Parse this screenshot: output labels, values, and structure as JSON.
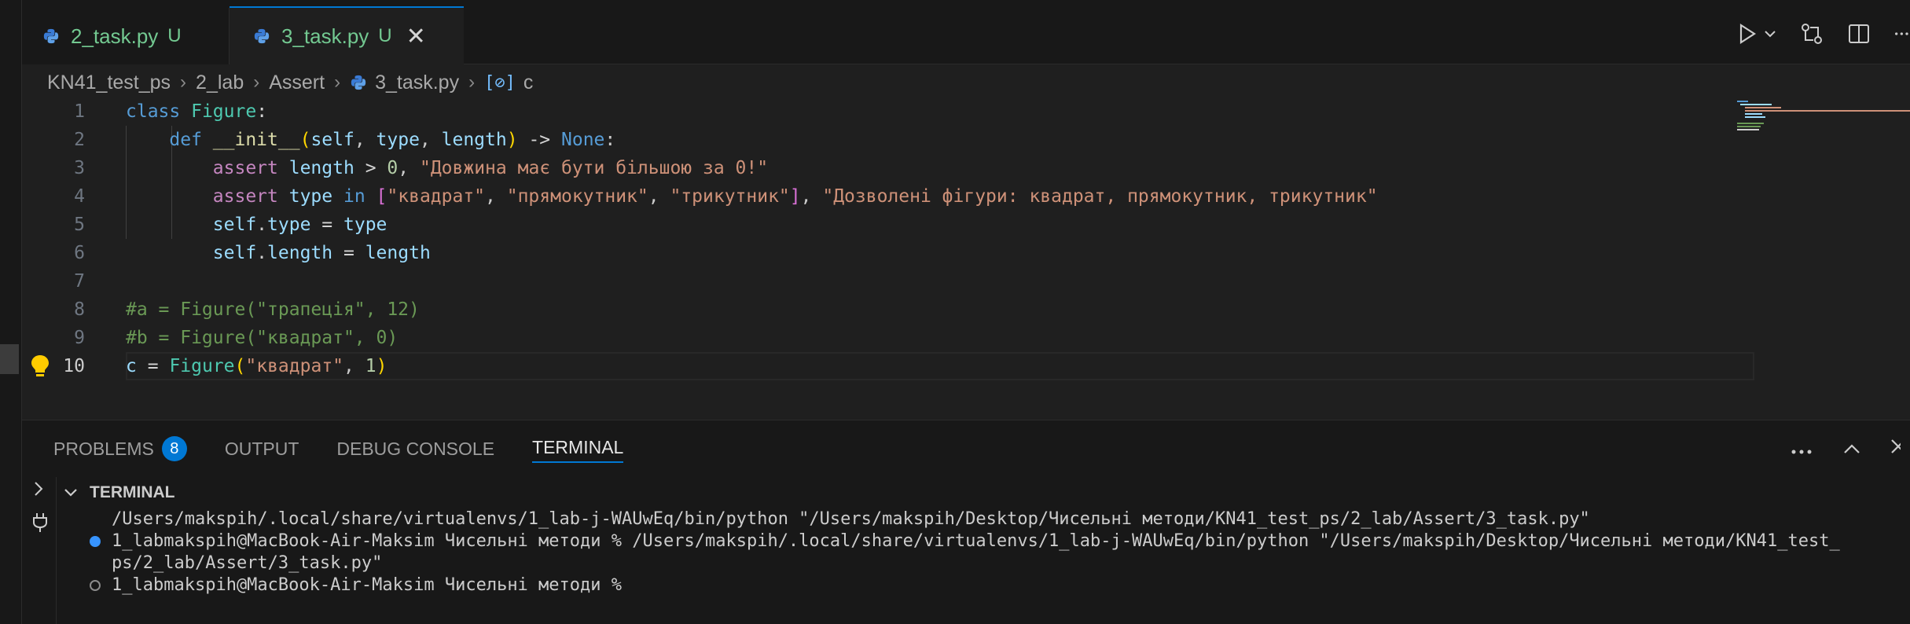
{
  "tabs": [
    {
      "label": "2_task.py",
      "status": "U",
      "active": false
    },
    {
      "label": "3_task.py",
      "status": "U",
      "active": true,
      "close": "✕"
    }
  ],
  "breadcrumb": [
    "KN41_test_ps",
    "2_lab",
    "Assert",
    "3_task.py",
    "c"
  ],
  "editor": {
    "lines": [
      {
        "n": "1"
      },
      {
        "n": "2"
      },
      {
        "n": "3"
      },
      {
        "n": "4"
      },
      {
        "n": "5"
      },
      {
        "n": "6"
      },
      {
        "n": "7"
      },
      {
        "n": "8"
      },
      {
        "n": "9"
      },
      {
        "n": "10"
      }
    ],
    "active_line": "10"
  },
  "panel": {
    "tabs": [
      "PROBLEMS",
      "OUTPUT",
      "DEBUG CONSOLE",
      "TERMINAL"
    ],
    "problems_count": "8",
    "active_tab": "TERMINAL",
    "terminal_header": "TERMINAL",
    "terminal_lines": [
      "/Users/makspih/.local/share/virtualenvs/1_lab-j-WAUwEq/bin/python \"/Users/makspih/Desktop/Чисельні методи/KN41_test_ps/2_lab/Assert/3_task.py\"",
      "1_labmakspih@MacBook-Air-Maksim Чисельні методи % /Users/makspih/.local/share/virtualenvs/1_lab-j-WAUwEq/bin/python \"/Users/makspih/Desktop/Чисельні методи/KN41_test_",
      "ps/2_lab/Assert/3_task.py\"",
      "1_labmakspih@MacBook-Air-Maksim Чисельні методи % "
    ]
  },
  "colors": {
    "accent": "#0078d4",
    "untracked": "#73c991",
    "background": "#1f1f1f"
  },
  "icons": [
    "python-file-icon",
    "close-icon",
    "run-icon",
    "chevron-down-icon",
    "compare-changes-icon",
    "split-editor-icon",
    "more-actions-icon",
    "variable-icon",
    "lightbulb-icon",
    "chevron-up-icon",
    "chevron-right-icon",
    "plug-icon"
  ]
}
